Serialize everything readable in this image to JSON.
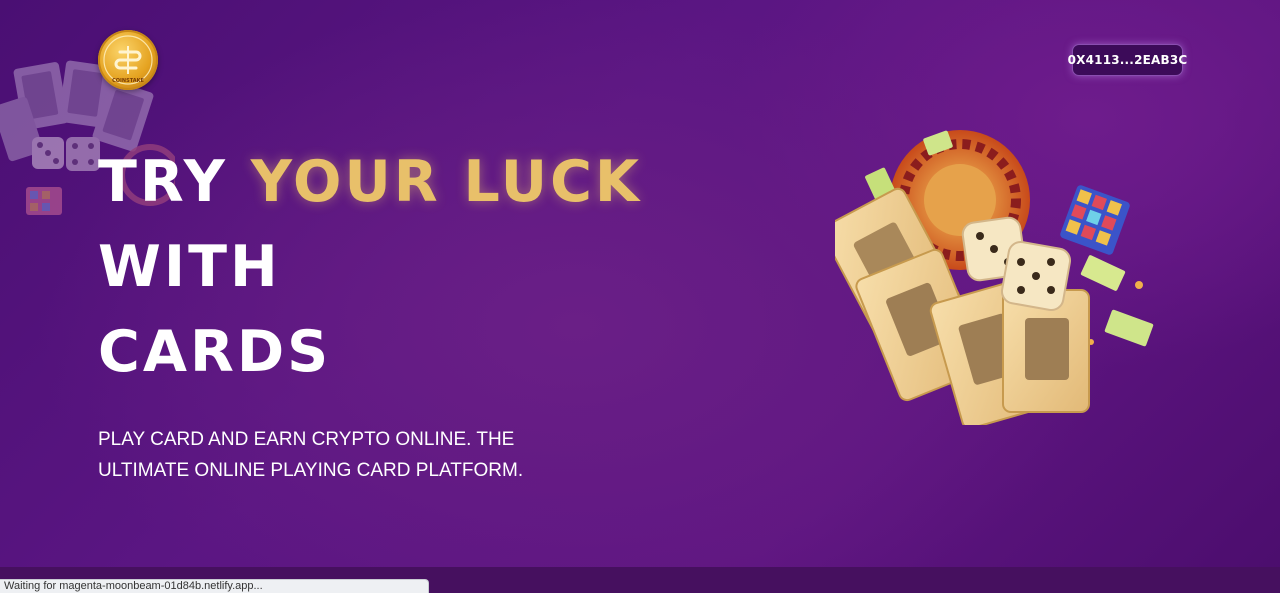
{
  "brand": {
    "logo_icon": "coinstake-logo",
    "logo_text": "COINSTAKE",
    "accent_color": "#e8c06a"
  },
  "header": {
    "wallet_address": "0X4113...2EAB3C"
  },
  "hero": {
    "headline_part1": "TRY ",
    "headline_accent": "YOUR LUCK",
    "headline_line2": "WITH",
    "headline_line3": "CARDS",
    "subtext": "PLAY CARD AND EARN CRYPTO ONLINE. THE ULTIMATE ONLINE PLAYING CARD PLATFORM.",
    "art_icon": "cards-dice-roulette-illustration"
  },
  "browser": {
    "status_text": "Waiting for magenta-moonbeam-01d84b.netlify.app..."
  }
}
